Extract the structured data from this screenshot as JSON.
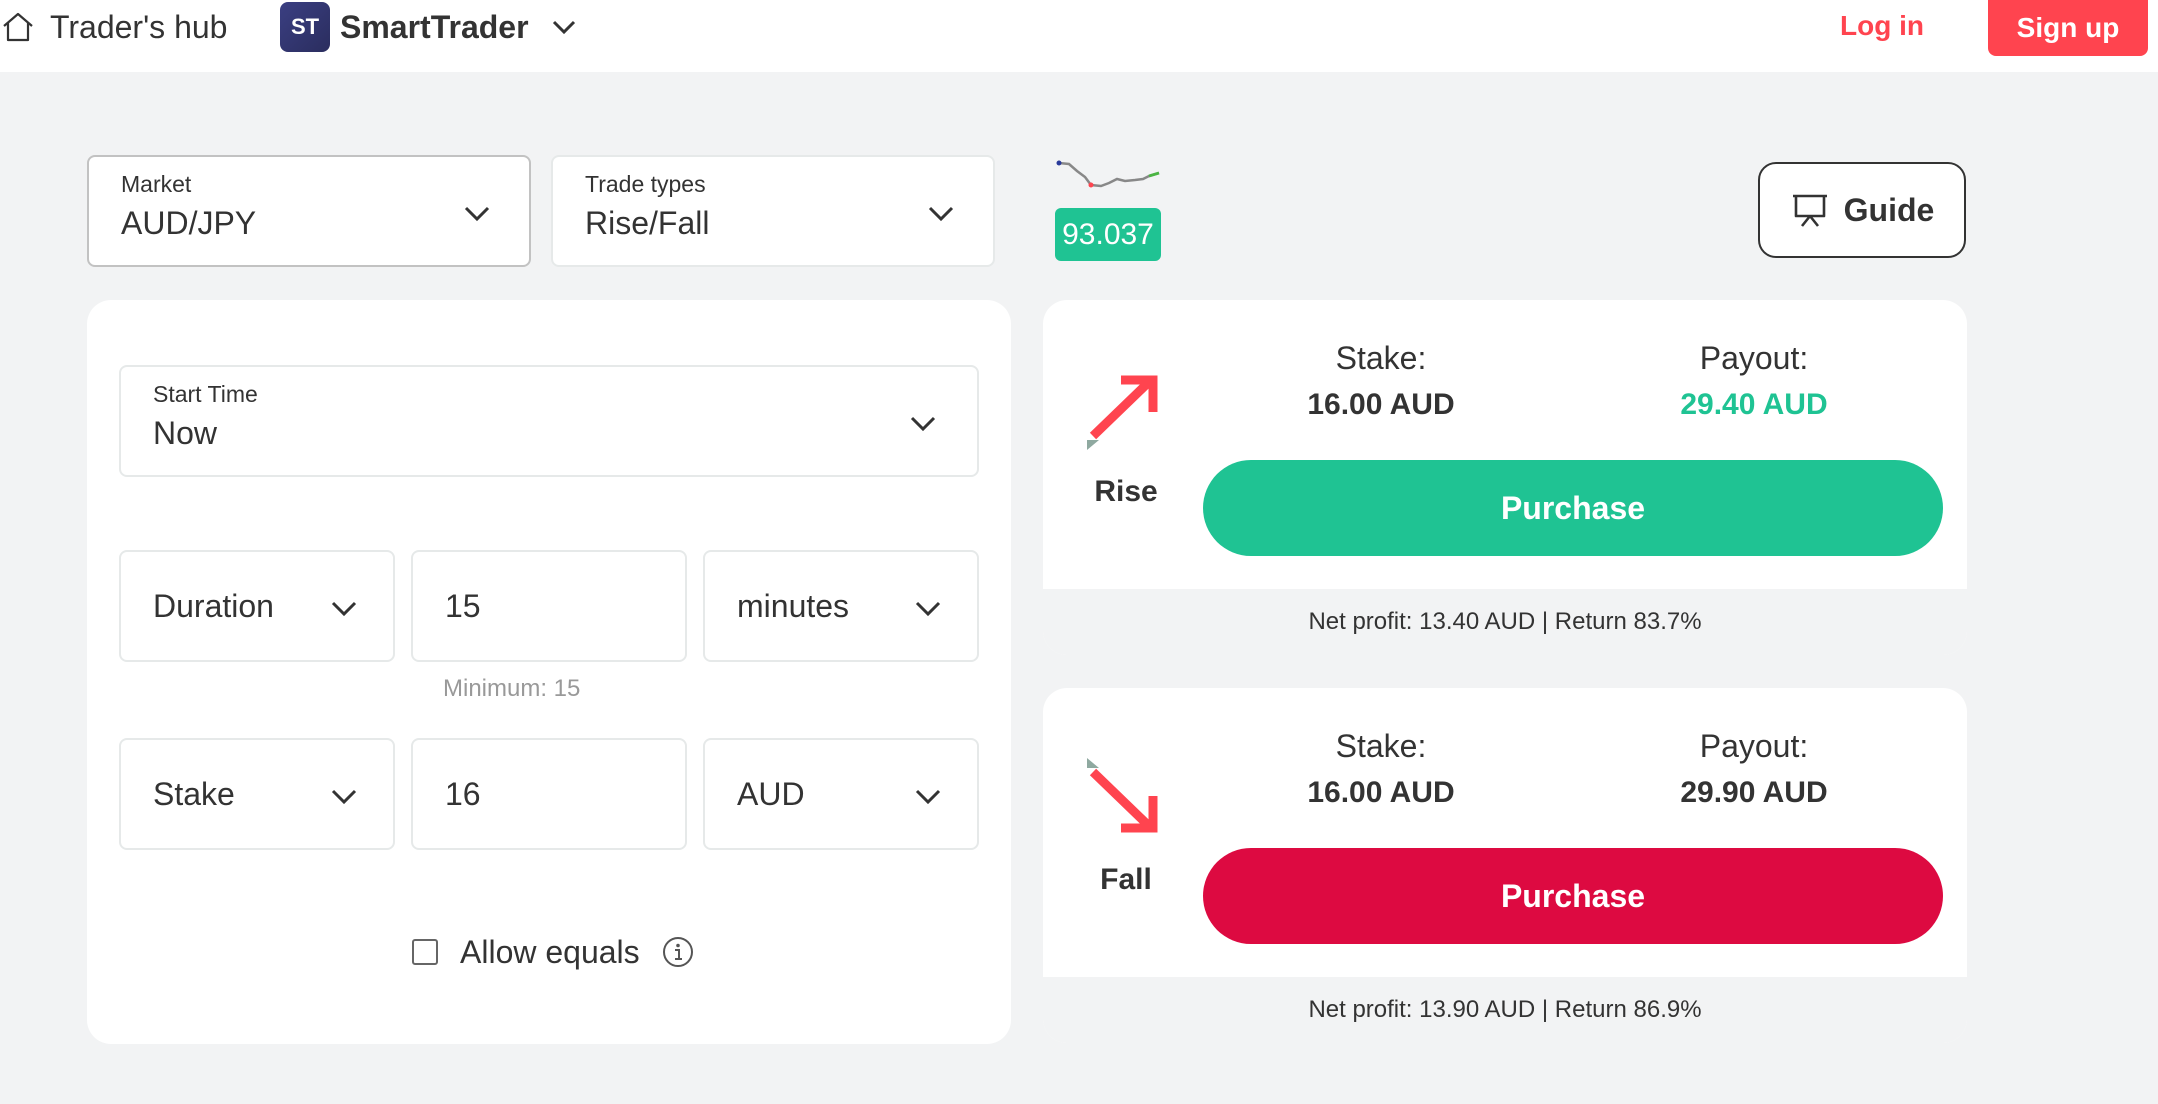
{
  "header": {
    "hub_label": "Trader's hub",
    "platform_logo_text": "ST",
    "platform_name": "SmartTrader",
    "login_label": "Log in",
    "signup_label": "Sign up"
  },
  "selectors": {
    "market": {
      "label": "Market",
      "value": "AUD/JPY"
    },
    "trade_types": {
      "label": "Trade types",
      "value": "Rise/Fall"
    }
  },
  "spot_price": "93.037",
  "guide_label": "Guide",
  "form": {
    "start_time": {
      "label": "Start Time",
      "value": "Now"
    },
    "duration": {
      "type": "Duration",
      "amount": "15",
      "unit": "minutes",
      "hint": "Minimum: 15"
    },
    "stake": {
      "type": "Stake",
      "amount": "16",
      "currency": "AUD"
    },
    "allow_equals": {
      "label": "Allow equals",
      "checked": false
    }
  },
  "contracts": [
    {
      "direction": "Rise",
      "stake_label": "Stake:",
      "stake_value": "16.00 AUD",
      "payout_label": "Payout:",
      "payout_value": "29.40 AUD",
      "payout_color": "#1fc393",
      "button_label": "Purchase",
      "button_color": "#1fc393",
      "footer": "Net profit: 13.40 AUD | Return 83.7%"
    },
    {
      "direction": "Fall",
      "stake_label": "Stake:",
      "stake_value": "16.00 AUD",
      "payout_label": "Payout:",
      "payout_value": "29.90 AUD",
      "payout_color": "#333333",
      "button_label": "Purchase",
      "button_color": "#dd0a41",
      "footer": "Net profit: 13.90 AUD | Return 86.9%"
    }
  ],
  "colors": {
    "brand_red": "#ff444f",
    "rise_green": "#1fc393",
    "fall_red": "#dd0a41"
  }
}
